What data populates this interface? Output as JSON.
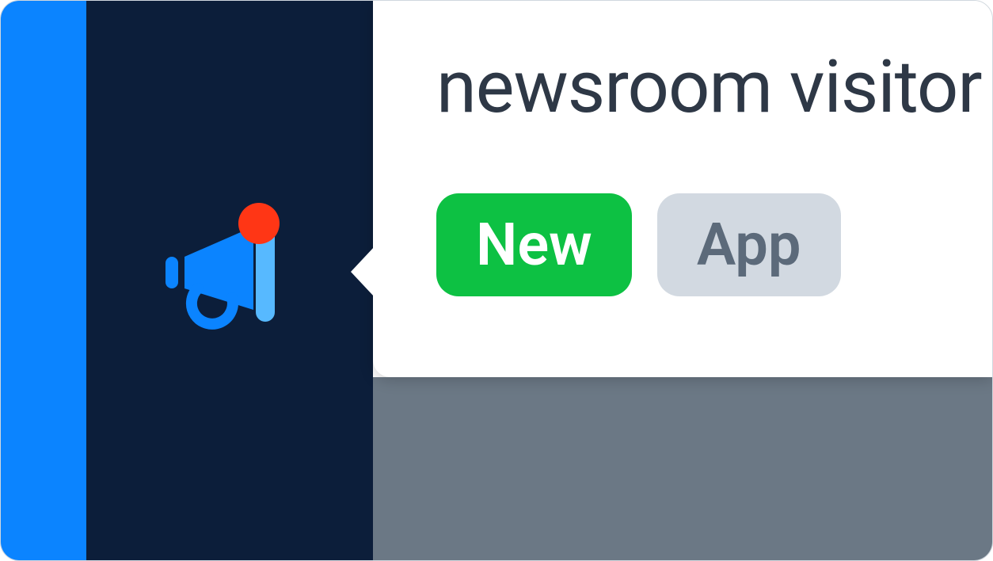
{
  "popover": {
    "title": "newsroom visitor",
    "badges": {
      "new": "New",
      "app": "App"
    }
  },
  "sidebar": {
    "icon": "megaphone-icon",
    "has_notification": true
  }
}
